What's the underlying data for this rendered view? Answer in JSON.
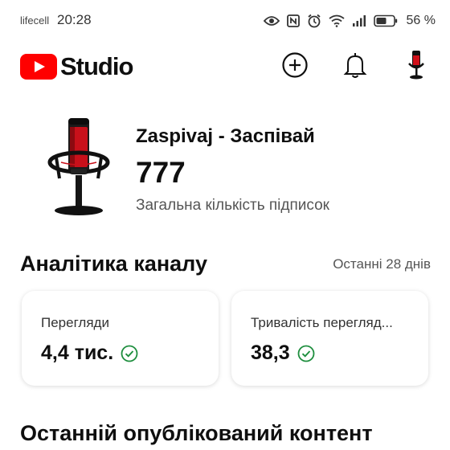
{
  "status_bar": {
    "carrier": "lifecell",
    "time": "20:28",
    "battery_percent": "56 %",
    "icons": [
      "eye-icon",
      "nfc-icon",
      "alarm-icon",
      "wifi-icon",
      "signal-icon",
      "battery-icon"
    ]
  },
  "app_bar": {
    "logo_text": "Studio",
    "icons": [
      "create-icon",
      "bell-icon",
      "account-avatar"
    ]
  },
  "channel": {
    "name": "Zaspivaj - Заспівай",
    "subscriber_count": "777",
    "subscriber_label": "Загальна кількість підписок"
  },
  "analytics": {
    "title": "Аналітика каналу",
    "period": "Останні 28 днів",
    "cards": [
      {
        "label": "Перегляди",
        "value": "4,4 тис."
      },
      {
        "label": "Тривалість перегляд...",
        "value": "38,3"
      }
    ]
  },
  "recent": {
    "title": "Останній опублікований контент"
  },
  "colors": {
    "brand_red": "#ff0000",
    "check_green": "#1e8e3e"
  }
}
